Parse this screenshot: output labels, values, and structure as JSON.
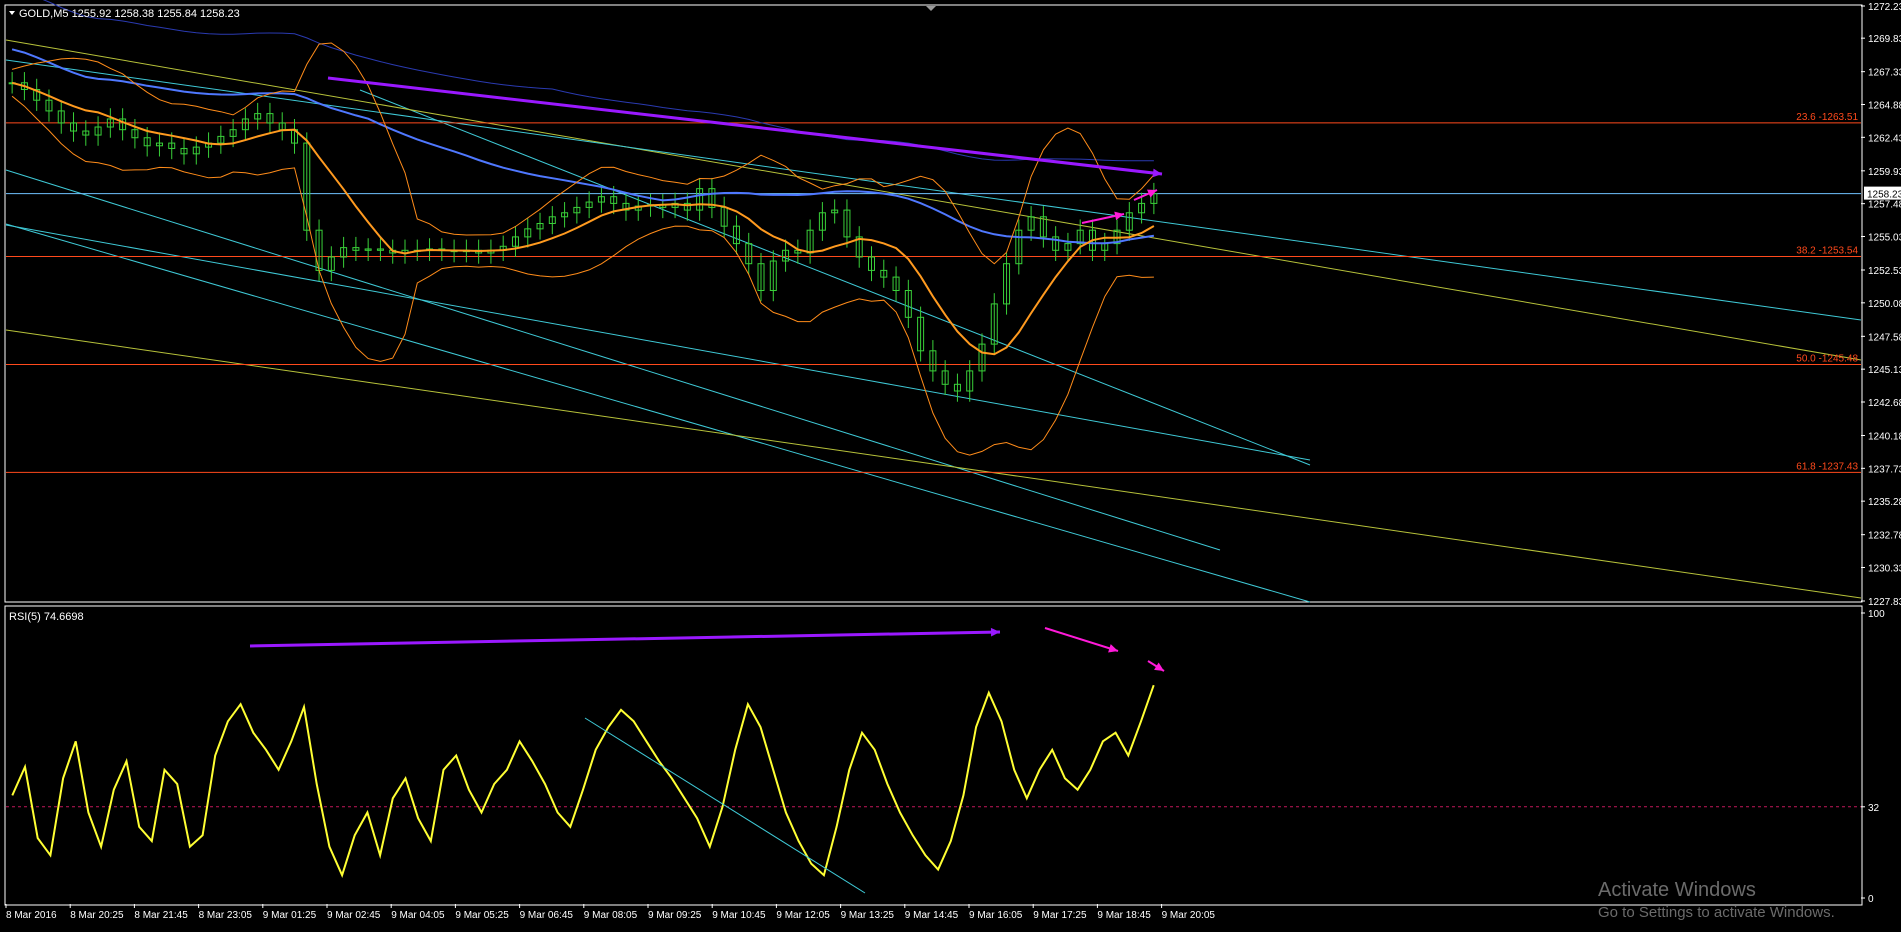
{
  "window": {
    "symbol_header": "GOLD,M5  1255.92 1258.38 1255.84 1258.23",
    "rsi_header": "RSI(5) 74.6698",
    "current_price_tag": "1258.23"
  },
  "watermark": {
    "line1": "Activate Windows",
    "line2": "Go to Settings to activate Windows."
  },
  "colors": {
    "background": "#000000",
    "frame": "#ffffff",
    "candle": "#39d039",
    "bollinger": "#ff8c1a",
    "ma_orange": "#ff9a1f",
    "ma_blue": "#4f78ff",
    "ma_navy": "#2a3ab0",
    "fib": "#ff4a1c",
    "channel_cyan": "#3fc9d6",
    "channel_yellow": "#b7c23a",
    "rsi_line": "#ffff33",
    "rsi_level": "#c2185b",
    "arrow_purple": "#9a19ff",
    "arrow_magenta": "#ff1ad9",
    "price_line": "#6fc3ff"
  },
  "chart_data": [
    {
      "type": "candlestick",
      "title": "GOLD,M5",
      "ohlc_last": {
        "open": 1255.92,
        "high": 1258.38,
        "low": 1255.84,
        "close": 1258.23
      },
      "ylim": [
        1227.83,
        1272.23
      ],
      "y_ticks": [
        1272.23,
        1269.83,
        1267.33,
        1264.88,
        1262.43,
        1259.93,
        1257.48,
        1255.03,
        1252.53,
        1250.08,
        1247.58,
        1245.13,
        1242.68,
        1240.18,
        1237.73,
        1235.28,
        1232.78,
        1230.33,
        1227.83
      ],
      "x_ticks": [
        "8 Mar 2016",
        "8 Mar 20:25",
        "8 Mar 21:45",
        "8 Mar 23:05",
        "9 Mar 01:25",
        "9 Mar 02:45",
        "9 Mar 04:05",
        "9 Mar 05:25",
        "9 Mar 06:45",
        "9 Mar 08:05",
        "9 Mar 09:25",
        "9 Mar 10:45",
        "9 Mar 12:05",
        "9 Mar 13:25",
        "9 Mar 14:45",
        "9 Mar 16:05",
        "9 Mar 17:25",
        "9 Mar 18:45",
        "9 Mar 20:05"
      ],
      "fibonacci_levels": [
        {
          "label": "23.6 -1263.51",
          "price": 1263.51
        },
        {
          "label": "38.2 -1253.54",
          "price": 1253.54
        },
        {
          "label": "50.0 -1245.48",
          "price": 1245.48
        },
        {
          "label": "61.8 -1237.43",
          "price": 1237.43
        }
      ],
      "current_price": 1258.23,
      "close_series": [
        1266.5,
        1266.0,
        1265.2,
        1264.4,
        1263.5,
        1262.9,
        1262.6,
        1263.2,
        1263.8,
        1263.0,
        1262.4,
        1261.8,
        1262.0,
        1261.6,
        1261.2,
        1261.7,
        1262.0,
        1262.5,
        1263.0,
        1263.8,
        1264.2,
        1263.5,
        1263.0,
        1262.0,
        1255.5,
        1252.5,
        1253.5,
        1254.2,
        1254.0,
        1254.1,
        1254.0,
        1253.8,
        1254.0,
        1254.0,
        1254.1,
        1254.0,
        1253.9,
        1254.0,
        1253.8,
        1254.0,
        1254.3,
        1255.0,
        1255.6,
        1256.0,
        1256.5,
        1256.8,
        1257.2,
        1257.6,
        1258.0,
        1257.5,
        1257.0,
        1257.3,
        1257.4,
        1257.2,
        1257.5,
        1257.0,
        1258.6,
        1257.2,
        1255.8,
        1254.5,
        1253.0,
        1251.0,
        1253.2,
        1254.0,
        1253.8,
        1255.5,
        1256.8,
        1257.0,
        1255.0,
        1253.5,
        1252.5,
        1252.0,
        1251.0,
        1249.0,
        1246.5,
        1245.0,
        1244.0,
        1243.5,
        1245.0,
        1247.0,
        1250.0,
        1253.0,
        1255.5,
        1256.5,
        1255.0,
        1254.0,
        1254.5,
        1255.5,
        1254.0,
        1254.5,
        1255.5,
        1256.8,
        1257.5,
        1258.23
      ]
    },
    {
      "type": "line",
      "title": "RSI(5) 74.6698",
      "ylim": [
        0,
        100
      ],
      "y_ticks": [
        100,
        32,
        0
      ],
      "level": 32,
      "last_value": 74.6698,
      "series": [
        {
          "values": [
            36,
            46,
            21,
            15,
            42,
            55,
            30,
            18,
            38,
            48,
            25,
            20,
            45,
            40,
            18,
            22,
            50,
            62,
            68,
            58,
            52,
            45,
            55,
            67,
            40,
            18,
            8,
            22,
            30,
            15,
            35,
            42,
            28,
            20,
            45,
            50,
            38,
            30,
            40,
            45,
            55,
            48,
            40,
            30,
            25,
            38,
            52,
            60,
            66,
            62,
            55,
            48,
            42,
            35,
            28,
            18,
            32,
            52,
            68,
            60,
            45,
            30,
            20,
            12,
            8,
            25,
            45,
            58,
            52,
            40,
            30,
            22,
            15,
            10,
            20,
            36,
            60,
            72,
            62,
            45,
            35,
            45,
            52,
            42,
            38,
            45,
            55,
            58,
            50,
            62,
            74.67
          ]
        }
      ]
    }
  ]
}
